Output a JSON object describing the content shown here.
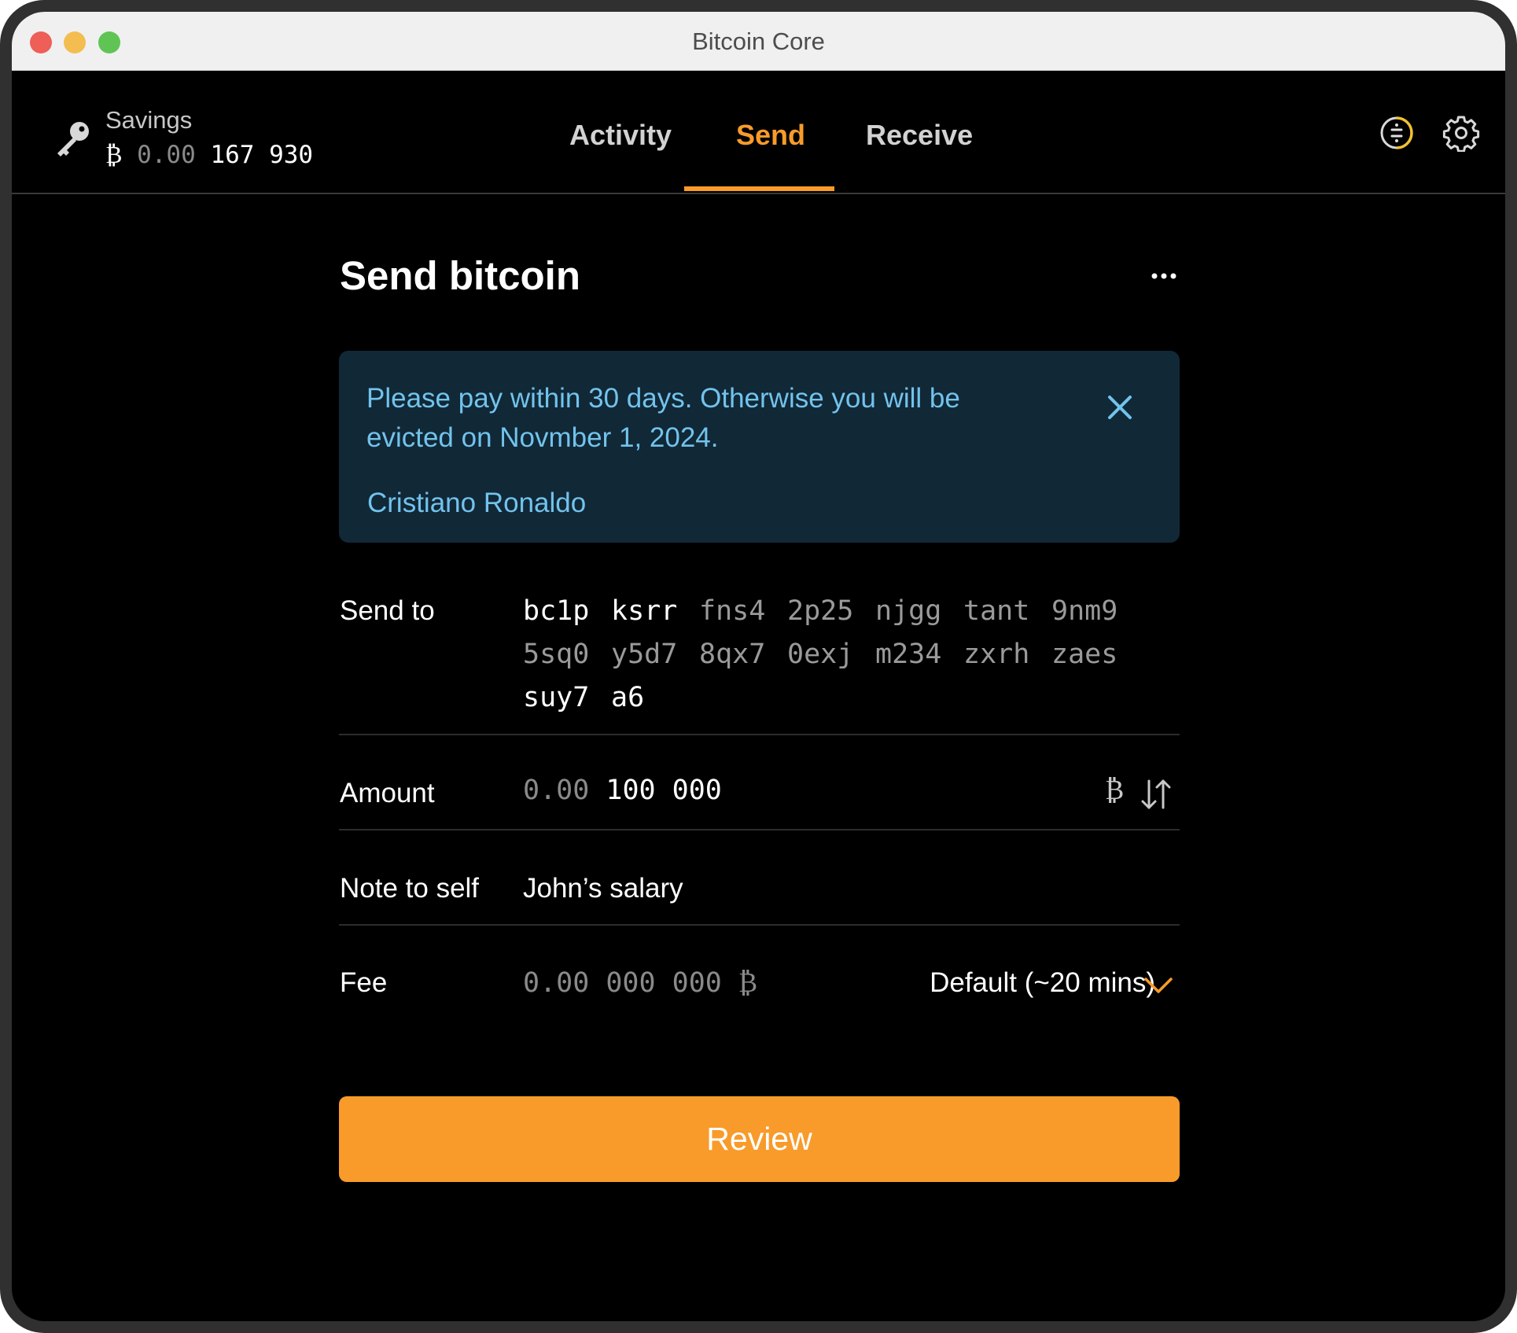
{
  "window": {
    "title": "Bitcoin Core"
  },
  "wallet": {
    "icon": "key-icon",
    "name": "Savings",
    "balance_symbol": "₿",
    "balance_dim": "0.00",
    "balance_main": "167 930"
  },
  "nav": {
    "tabs": [
      {
        "label": "Activity",
        "active": false
      },
      {
        "label": "Send",
        "active": true
      },
      {
        "label": "Receive",
        "active": false
      }
    ],
    "accent": "#f89b2a",
    "icons": [
      "block-clock-icon",
      "gear-icon"
    ]
  },
  "page": {
    "title": "Send bitcoin",
    "menu_icon": "more-icon"
  },
  "banner": {
    "message": "Please pay within 30 days. Otherwise you will be evicted on Novmber 1, 2024.",
    "signature": "Cristiano Ronaldo",
    "background": "#112837",
    "text_color": "#72c3ec"
  },
  "form": {
    "send_to": {
      "label": "Send to",
      "address_lines": [
        [
          "bc1p",
          "ksrr",
          "fns4",
          "2p25",
          "njgg",
          "tant",
          "9nm9"
        ],
        [
          "5sq0",
          "y5d7",
          "8qx7",
          "0exj",
          "m234",
          "zxrh",
          "zaes"
        ],
        [
          "suy7",
          "a6"
        ]
      ]
    },
    "amount": {
      "label": "Amount",
      "value_dim": "0.00",
      "value_main": "100 000",
      "unit": "₿"
    },
    "note": {
      "label": "Note to self",
      "value": "John’s salary"
    },
    "fee": {
      "label": "Fee",
      "value": "0.00 000 000 ₿",
      "speed": "Default (~20 mins)"
    }
  },
  "review_button": {
    "label": "Review"
  }
}
